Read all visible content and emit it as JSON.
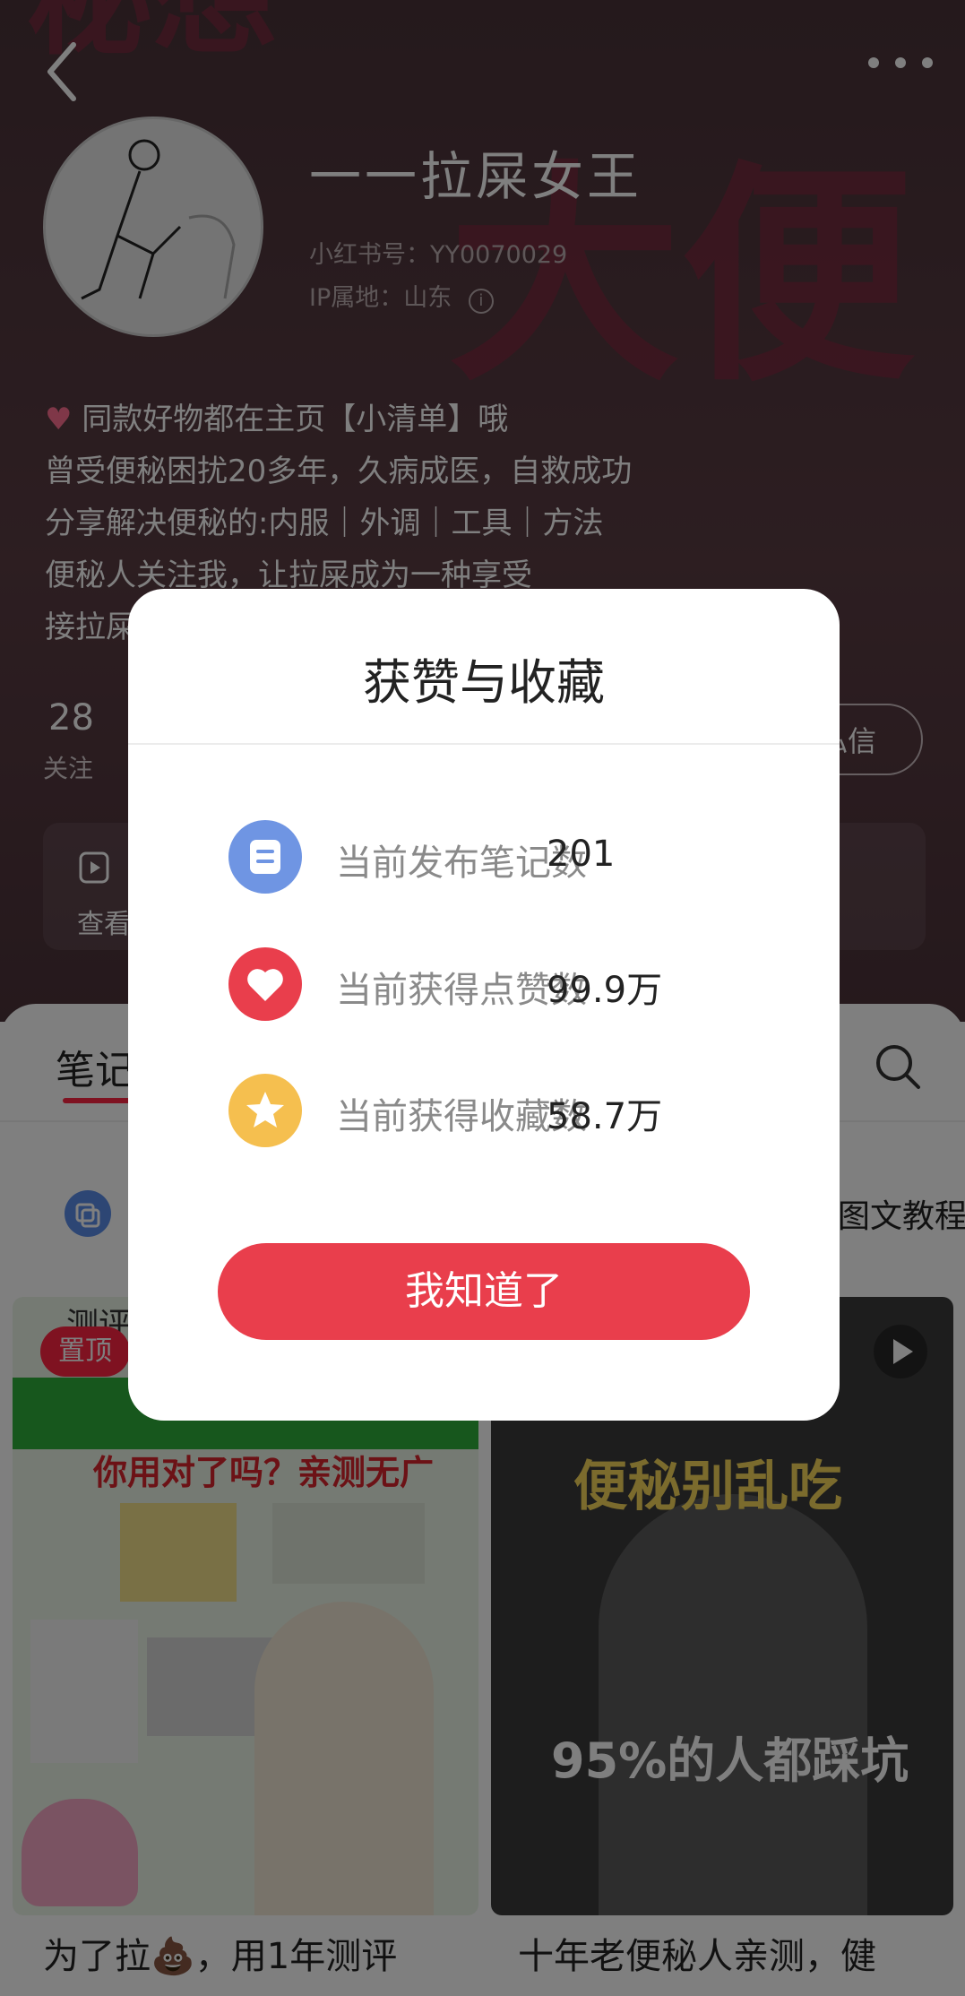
{
  "profile": {
    "nickname": "一一拉屎女王",
    "red_id": "小红书号：YY0070029",
    "ip_location": "IP属地：山东",
    "bio": [
      "同款好物都在主页【小清单】哦",
      "曾受便秘困扰20多年，久病成医，自救成功",
      "分享解决便秘的:内服｜外调｜工具｜方法",
      "便秘人关注我，让拉屎成为一种享受",
      "接拉屎"
    ],
    "stats": {
      "following_count": "28",
      "following_label": "关注"
    },
    "message_button": "私信",
    "card_label": "查看",
    "cover_words": {
      "top": "秘想",
      "right": "大便"
    }
  },
  "tabs": {
    "active": "笔记"
  },
  "collection": {
    "left_label": "",
    "right_label": "图文教程"
  },
  "notes": [
    {
      "badge": "置顶",
      "title": "为了拉💩，用1年测评",
      "cover_heading": "测评",
      "cover_text": "你用对了吗？亲测无广"
    },
    {
      "title": "十年老便秘人亲测，健",
      "cover_text_top": "便秘别乱吃",
      "cover_text_bottom": "95%的人都踩坑"
    }
  ],
  "modal": {
    "title": "获赞与收藏",
    "rows": [
      {
        "label": "当前发布笔记数",
        "value": "201",
        "icon": "note-icon",
        "color": "#6f95e3"
      },
      {
        "label": "当前获得点赞数",
        "value": "99.9万",
        "icon": "heart-icon",
        "color": "#e93e4c"
      },
      {
        "label": "当前获得收藏数",
        "value": "58.7万",
        "icon": "star-icon",
        "color": "#f5bf4f"
      }
    ],
    "confirm_button": "我知道了"
  }
}
